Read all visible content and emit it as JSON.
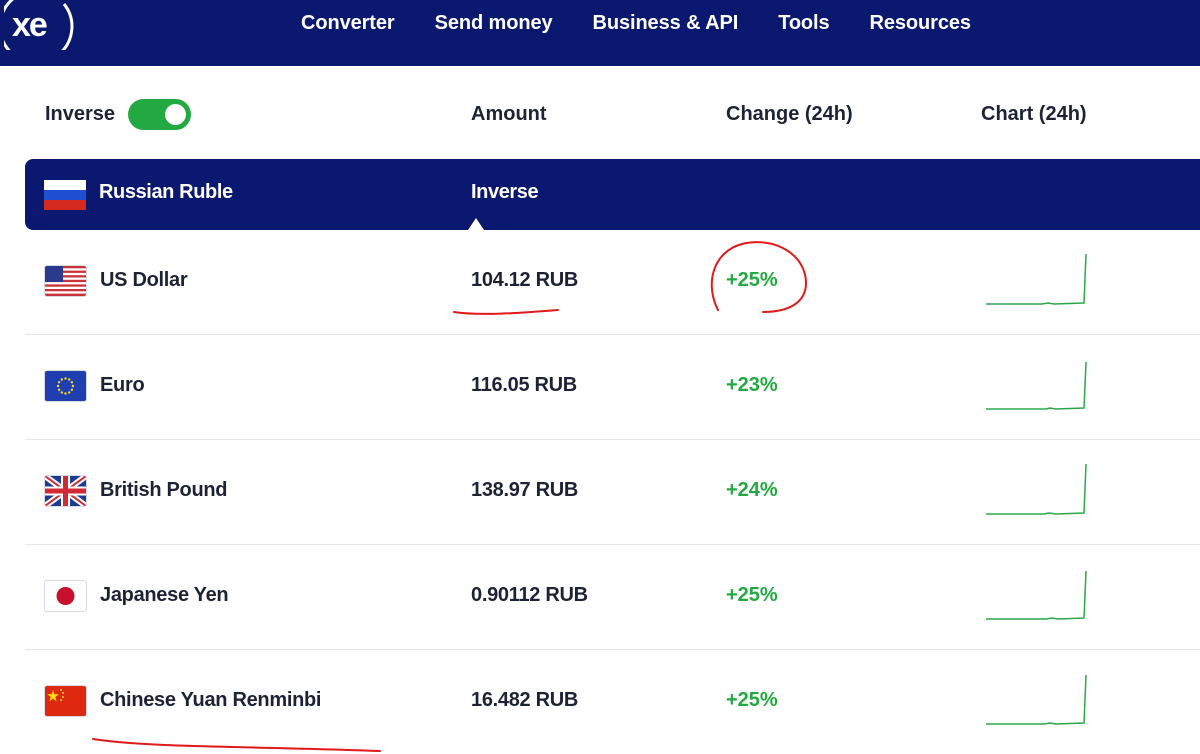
{
  "brand": {
    "logo_text": "xe",
    "bar_color": "#0b1870"
  },
  "nav": {
    "items": [
      {
        "label": "Converter"
      },
      {
        "label": "Send money"
      },
      {
        "label": "Business & API"
      },
      {
        "label": "Tools"
      },
      {
        "label": "Resources"
      }
    ]
  },
  "header": {
    "inverse_label": "Inverse",
    "inverse_on": true,
    "amount_label": "Amount",
    "change_label": "Change (24h)",
    "chart_label": "Chart (24h)"
  },
  "base": {
    "name": "Russian Ruble",
    "flag": "russia-flag-icon",
    "column_label": "Inverse"
  },
  "rows": [
    {
      "name": "US Dollar",
      "flag": "usa-flag-icon",
      "amount": "104.12 RUB",
      "change": "+25%"
    },
    {
      "name": "Euro",
      "flag": "eu-flag-icon",
      "amount": "116.05 RUB",
      "change": "+23%"
    },
    {
      "name": "British Pound",
      "flag": "uk-flag-icon",
      "amount": "138.97 RUB",
      "change": "+24%"
    },
    {
      "name": "Japanese Yen",
      "flag": "japan-flag-icon",
      "amount": "0.90112 RUB",
      "change": "+25%"
    },
    {
      "name": "Chinese Yuan Renminbi",
      "flag": "china-flag-icon",
      "amount": "16.482 RUB",
      "change": "+25%"
    }
  ],
  "colors": {
    "positive": "#23a941",
    "text": "#1d2335",
    "annotation": "#e01a1a"
  }
}
